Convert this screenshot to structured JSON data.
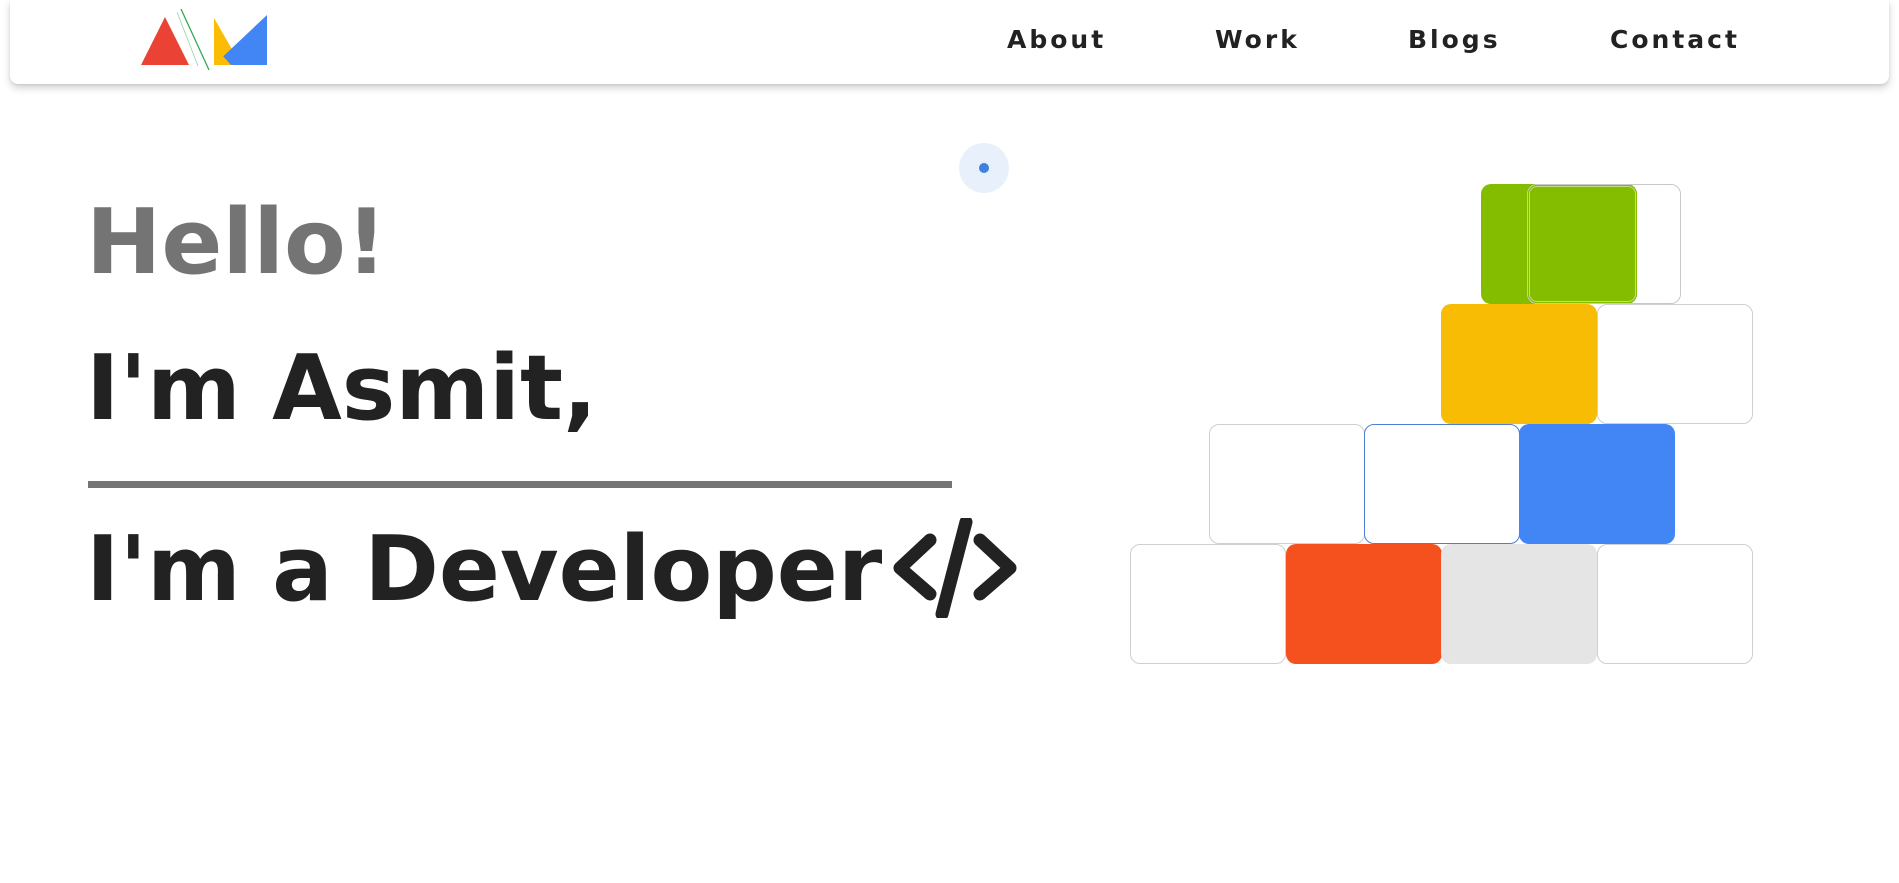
{
  "nav": {
    "logo_alt": "AM",
    "links": [
      {
        "label": "About"
      },
      {
        "label": "Work"
      },
      {
        "label": "Blogs"
      },
      {
        "label": "Contact"
      }
    ]
  },
  "hero": {
    "greeting": "Hello!",
    "name_line": "I'm Asmit,",
    "role_line": "I'm a Developer"
  },
  "colors": {
    "logo_red": "#ea4335",
    "logo_yellow": "#fbbc05",
    "logo_blue": "#4285f4",
    "logo_green_line": "#34a853",
    "tile_green": "#84bd00",
    "tile_yellow": "#f9bc05",
    "tile_blue": "#4285f4",
    "tile_orange": "#f4511e",
    "tile_gray": "#e5e5e5",
    "tile_outline_blue": "#4d7fd6",
    "cursor_dot": "#3e82dd",
    "cursor_ring": "#e8f1fb",
    "text_dark": "#222222",
    "text_gray": "#747474"
  },
  "icons": {
    "logo": "am-logo-icon",
    "code": "code-brackets-icon"
  }
}
